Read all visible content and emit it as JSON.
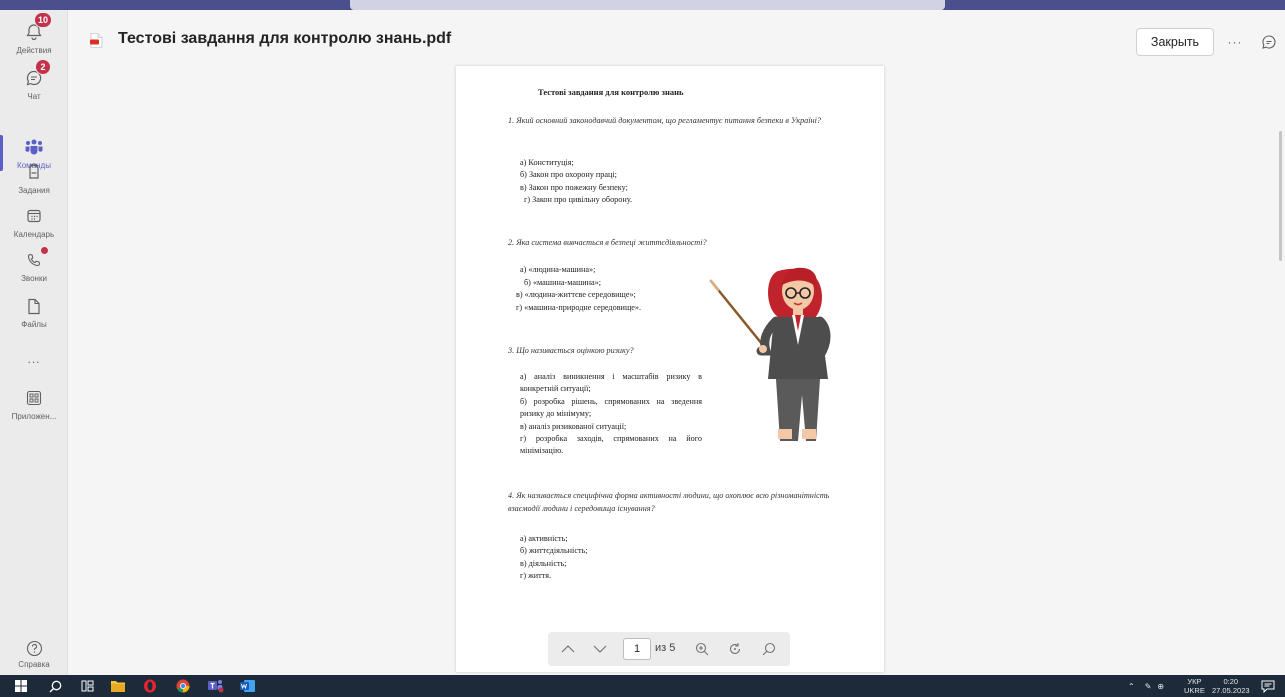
{
  "rail": {
    "items": [
      {
        "label": "Действия",
        "badge": "10"
      },
      {
        "label": "Чат",
        "badge": "2"
      },
      {
        "label": "Команды"
      },
      {
        "label": "Задания"
      },
      {
        "label": "Календарь"
      },
      {
        "label": "Звонки"
      },
      {
        "label": "Файлы"
      },
      {
        "label": "Приложен..."
      }
    ],
    "more_label": "...",
    "help_label": "Справка"
  },
  "header": {
    "title": "Тестові завдання для контролю знань.pdf",
    "close_label": "Закрыть",
    "more_label": "···"
  },
  "document": {
    "title": "Тестові завдання для контролю знань",
    "questions": [
      {
        "text": "1. Який основний законодавчий документом, що регламентує питання безпеки в Україні?",
        "answers": [
          "а) Конституція;",
          "б) Закон про охорону праці;",
          "в) Закон про пожежну безпеку;",
          "г) Закон про цивільну оборону."
        ]
      },
      {
        "text": "2. Яка система вивчається в безпеці життєдіяльності?",
        "answers": [
          "а) «людина-машина»;",
          "б) «машина-машина»;",
          "в) «людина-життєве середовище»;",
          "г) «машина-природне середовище»."
        ]
      },
      {
        "text": "3. Що називається оцінкою ризику?",
        "answers": [
          "а) аналіз виникнення і масштабів ризику в конкретній ситуації;",
          "б) розробка рішень, спрямованих на зведення ризику до мінімуму;",
          "в) аналіз ризикованої ситуації;",
          "г) розробка заходів, спрямованих на його мінімізацію."
        ]
      },
      {
        "text": "4. Як називається специфічна форма активності людини, що охоплює всю різноманітність взаємодії людини і середовища існування?",
        "answers": [
          "а) активність;",
          "б) життєдіяльність;",
          "в) діяльність;",
          "г) життя."
        ]
      }
    ]
  },
  "pdf_toolbar": {
    "current_page": "1",
    "of_label": "из 5"
  },
  "taskbar": {
    "lang": "УКР",
    "lang_sub": "UKRE",
    "time": "0:20",
    "date": "27.05.2023"
  },
  "colors": {
    "accent": "#5b5fc7",
    "badge": "#c4314b",
    "taskbar": "#1d2a3a",
    "topstrip": "#4b4f8c"
  }
}
